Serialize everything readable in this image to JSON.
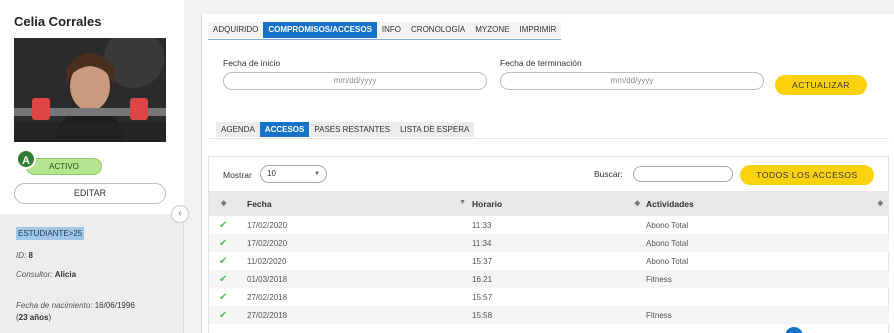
{
  "client": {
    "name": "Celia Corrales",
    "badge_letter": "A",
    "status": "ACTIVO",
    "edit_label": "EDITAR",
    "tag": "ESTUDIANTE>25",
    "id_label": "ID:",
    "id_value": "8",
    "consultor_label": "Consultor:",
    "consultor_value": "Alicia",
    "birth_label": "Fecha de nacimiento:",
    "birth_value": "16/06/1996",
    "age": "23 años"
  },
  "top_tabs": [
    "ADQUIRIDO",
    "COMPROMISOS/ACCESOS",
    "INFO",
    "CRONOLOGÍA",
    "MYZONE",
    "IMPRIMIR"
  ],
  "top_tab_active": 1,
  "filters": {
    "start_label": "Fecha de inicio",
    "start_placeholder": "mm/dd/yyyy",
    "end_label": "Fecha de terminación",
    "end_placeholder": "mm/dd/yyyy",
    "update_label": "ACTUALIZAR"
  },
  "sub_tabs": [
    "AGENDA",
    "ACCESOS",
    "PASES RESTANTES",
    "LISTA DE ESPERA"
  ],
  "sub_tab_active": 1,
  "table_controls": {
    "show_label": "Mostrar",
    "show_value": "10",
    "search_label": "Buscar:",
    "all_access_label": "TODOS LOS ACCESOS"
  },
  "table": {
    "headers": [
      "",
      "Fecha",
      "Horario",
      "Actividades"
    ],
    "rows": [
      [
        "17/02/2020",
        "11:33",
        "Abono Total"
      ],
      [
        "17/02/2020",
        "11:34",
        "Abono Total"
      ],
      [
        "11/02/2020",
        "15:37",
        "Abono Total"
      ],
      [
        "01/03/2018",
        "16:21",
        "Fitness"
      ],
      [
        "27/02/2018",
        "15:57",
        ""
      ],
      [
        "27/02/2018",
        "15:58",
        "Fitness"
      ]
    ]
  },
  "colors": {
    "accent": "#1472c8",
    "button_yellow": "#fcd20f",
    "active_green": "#b6e58f",
    "check_green": "#5cb85c"
  }
}
